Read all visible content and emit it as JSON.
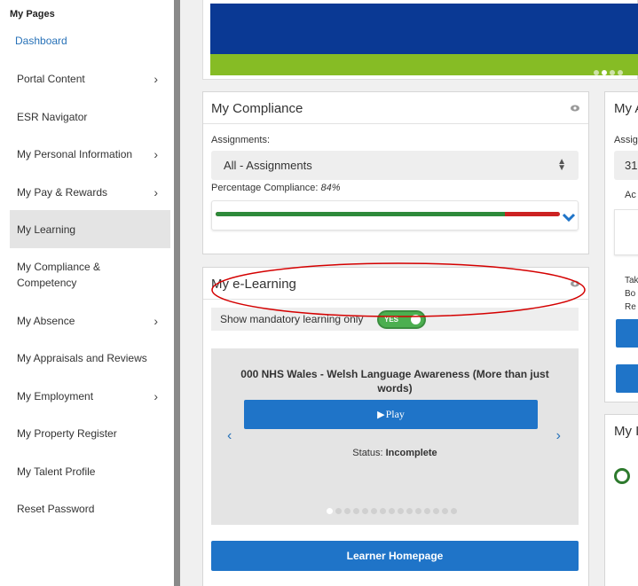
{
  "sidebar": {
    "title": "My Pages",
    "dashboard": "Dashboard",
    "items": [
      {
        "label": "Portal Content",
        "has_submenu": true
      },
      {
        "label": "ESR Navigator",
        "has_submenu": false
      },
      {
        "label": "My Personal Information",
        "has_submenu": true
      },
      {
        "label": "My Pay & Rewards",
        "has_submenu": true
      },
      {
        "label": "My Learning",
        "has_submenu": false,
        "active": true
      },
      {
        "label": "My Compliance & Competency",
        "has_submenu": false
      },
      {
        "label": "My Absence",
        "has_submenu": true
      },
      {
        "label": "My Appraisals and Reviews",
        "has_submenu": false
      },
      {
        "label": "My Employment",
        "has_submenu": true
      },
      {
        "label": "My Property Register",
        "has_submenu": false
      },
      {
        "label": "My Talent Profile",
        "has_submenu": false
      },
      {
        "label": "Reset Password",
        "has_submenu": false
      }
    ],
    "chevron": "›"
  },
  "compliance": {
    "title": "My Compliance",
    "assignments_label": "Assignments:",
    "assignments_value": "All - Assignments",
    "pct_label": "Percentage Compliance:",
    "pct_value": "84%",
    "fraction": 0.84,
    "colors": {
      "good": "#2d8a3a",
      "bad": "#cc2222"
    }
  },
  "elearning": {
    "title": "My e-Learning",
    "toggle_label": "Show mandatory learning only",
    "toggle_value": "YES",
    "course_title": "000 NHS Wales - Welsh Language Awareness (More than just words)",
    "play_label": "Play",
    "status_label": "Status:",
    "status_value": "Incomplete",
    "prev_arrow": "‹",
    "next_arrow": "›",
    "learner_button": "Learner Homepage"
  },
  "right_panel_1": {
    "title": "My A",
    "assign_label": "Assig",
    "select_value": "31",
    "acc": "Ac",
    "lines": [
      "Tak",
      "Bo",
      "Re"
    ]
  },
  "right_panel_2": {
    "title": "My I"
  },
  "colors": {
    "accent": "#1f74c8",
    "link": "#2872b8",
    "banner_blue": "#0a3994",
    "banner_green": "#86bc25"
  }
}
